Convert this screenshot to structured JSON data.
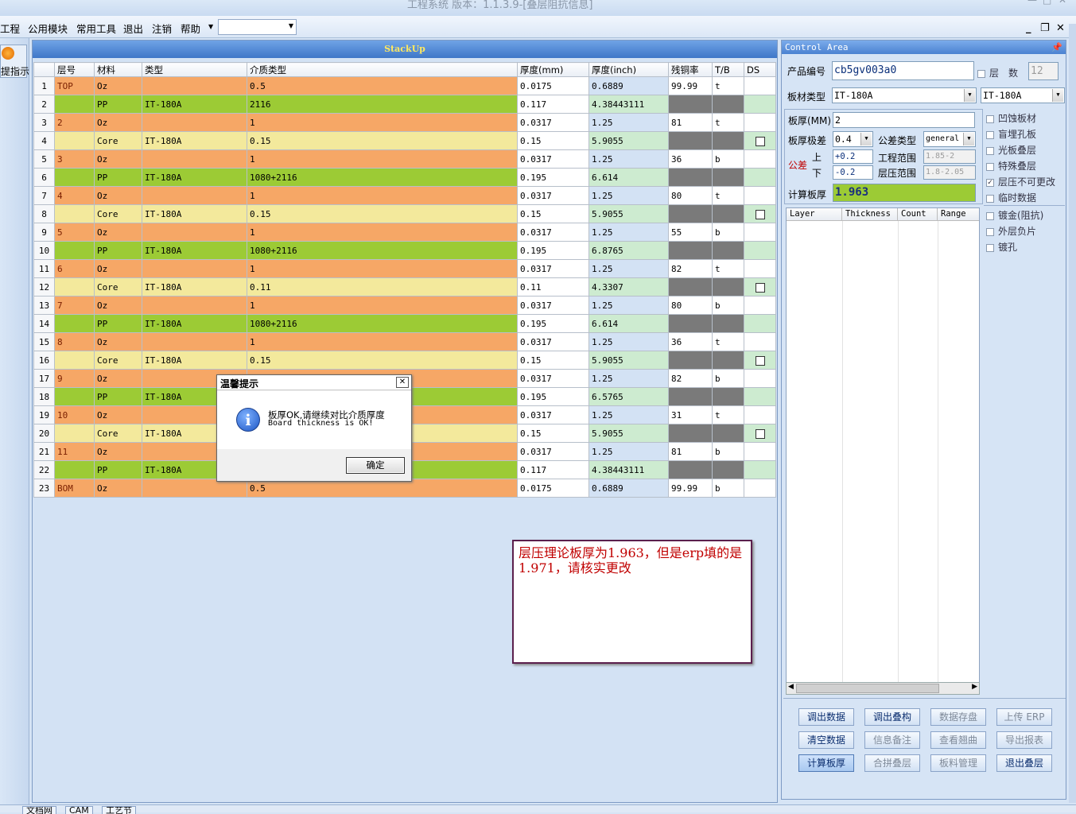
{
  "window": {
    "title": "工程系统 版本：1.1.3.9-[叠层阻抗信息]"
  },
  "menu": [
    "工程",
    "公用模块",
    "常用工具",
    "退出",
    "注销",
    "帮助"
  ],
  "left_nav": {
    "label": "提指示"
  },
  "stackup": {
    "title": "StackUp",
    "columns": [
      "层号",
      "材料",
      "类型",
      "介质类型",
      "厚度(mm)",
      "厚度(inch)",
      "残铜率",
      "T/B",
      "DS"
    ],
    "rows": [
      {
        "n": "1",
        "kind": "cu",
        "layer": "TOP",
        "mat": "Oz",
        "type": "",
        "diel": "0.5",
        "mm": "0.0175",
        "inch": "0.6889",
        "res": "99.99",
        "tb": "t",
        "ds": false
      },
      {
        "n": "2",
        "kind": "pp",
        "layer": "",
        "mat": "PP",
        "type": "IT-180A",
        "diel": "2116",
        "mm": "0.117",
        "inch": "4.38443111",
        "res": "",
        "tb": "",
        "ds": false
      },
      {
        "n": "3",
        "kind": "cu",
        "layer": "2",
        "mat": "Oz",
        "type": "",
        "diel": "1",
        "mm": "0.0317",
        "inch": "1.25",
        "res": "81",
        "tb": "t",
        "ds": false
      },
      {
        "n": "4",
        "kind": "co",
        "layer": "",
        "mat": "Core",
        "type": "IT-180A",
        "diel": "0.15",
        "mm": "0.15",
        "inch": "5.9055",
        "res": "",
        "tb": "",
        "ds": true
      },
      {
        "n": "5",
        "kind": "cu",
        "layer": "3",
        "mat": "Oz",
        "type": "",
        "diel": "1",
        "mm": "0.0317",
        "inch": "1.25",
        "res": "36",
        "tb": "b",
        "ds": false
      },
      {
        "n": "6",
        "kind": "pp",
        "layer": "",
        "mat": "PP",
        "type": "IT-180A",
        "diel": "1080+2116",
        "mm": "0.195",
        "inch": "6.614",
        "res": "",
        "tb": "",
        "ds": false
      },
      {
        "n": "7",
        "kind": "cu",
        "layer": "4",
        "mat": "Oz",
        "type": "",
        "diel": "1",
        "mm": "0.0317",
        "inch": "1.25",
        "res": "80",
        "tb": "t",
        "ds": false
      },
      {
        "n": "8",
        "kind": "co",
        "layer": "",
        "mat": "Core",
        "type": "IT-180A",
        "diel": "0.15",
        "mm": "0.15",
        "inch": "5.9055",
        "res": "",
        "tb": "",
        "ds": true
      },
      {
        "n": "9",
        "kind": "cu",
        "layer": "5",
        "mat": "Oz",
        "type": "",
        "diel": "1",
        "mm": "0.0317",
        "inch": "1.25",
        "res": "55",
        "tb": "b",
        "ds": false
      },
      {
        "n": "10",
        "kind": "pp",
        "layer": "",
        "mat": "PP",
        "type": "IT-180A",
        "diel": "1080+2116",
        "mm": "0.195",
        "inch": "6.8765",
        "res": "",
        "tb": "",
        "ds": false
      },
      {
        "n": "11",
        "kind": "cu",
        "layer": "6",
        "mat": "Oz",
        "type": "",
        "diel": "1",
        "mm": "0.0317",
        "inch": "1.25",
        "res": "82",
        "tb": "t",
        "ds": false
      },
      {
        "n": "12",
        "kind": "co",
        "layer": "",
        "mat": "Core",
        "type": "IT-180A",
        "diel": "0.11",
        "mm": "0.11",
        "inch": "4.3307",
        "res": "",
        "tb": "",
        "ds": true
      },
      {
        "n": "13",
        "kind": "cu",
        "layer": "7",
        "mat": "Oz",
        "type": "",
        "diel": "1",
        "mm": "0.0317",
        "inch": "1.25",
        "res": "80",
        "tb": "b",
        "ds": false
      },
      {
        "n": "14",
        "kind": "pp",
        "layer": "",
        "mat": "PP",
        "type": "IT-180A",
        "diel": "1080+2116",
        "mm": "0.195",
        "inch": "6.614",
        "res": "",
        "tb": "",
        "ds": false
      },
      {
        "n": "15",
        "kind": "cu",
        "layer": "8",
        "mat": "Oz",
        "type": "",
        "diel": "1",
        "mm": "0.0317",
        "inch": "1.25",
        "res": "36",
        "tb": "t",
        "ds": false
      },
      {
        "n": "16",
        "kind": "co",
        "layer": "",
        "mat": "Core",
        "type": "IT-180A",
        "diel": "0.15",
        "mm": "0.15",
        "inch": "5.9055",
        "res": "",
        "tb": "",
        "ds": true
      },
      {
        "n": "17",
        "kind": "cu",
        "layer": "9",
        "mat": "Oz",
        "type": "",
        "diel": "",
        "mm": "0.0317",
        "inch": "1.25",
        "res": "82",
        "tb": "b",
        "ds": false
      },
      {
        "n": "18",
        "kind": "pp",
        "layer": "",
        "mat": "PP",
        "type": "IT-180A",
        "diel": "",
        "mm": "0.195",
        "inch": "6.5765",
        "res": "",
        "tb": "",
        "ds": false
      },
      {
        "n": "19",
        "kind": "cu",
        "layer": "10",
        "mat": "Oz",
        "type": "",
        "diel": "",
        "mm": "0.0317",
        "inch": "1.25",
        "res": "31",
        "tb": "t",
        "ds": false
      },
      {
        "n": "20",
        "kind": "co",
        "layer": "",
        "mat": "Core",
        "type": "IT-180A",
        "diel": "",
        "mm": "0.15",
        "inch": "5.9055",
        "res": "",
        "tb": "",
        "ds": true
      },
      {
        "n": "21",
        "kind": "cu",
        "layer": "11",
        "mat": "Oz",
        "type": "",
        "diel": "",
        "mm": "0.0317",
        "inch": "1.25",
        "res": "81",
        "tb": "b",
        "ds": false
      },
      {
        "n": "22",
        "kind": "pp",
        "layer": "",
        "mat": "PP",
        "type": "IT-180A",
        "diel": "",
        "mm": "0.117",
        "inch": "4.38443111",
        "res": "",
        "tb": "",
        "ds": false
      },
      {
        "n": "23",
        "kind": "cu",
        "layer": "BOM",
        "mat": "Oz",
        "type": "",
        "diel": "0.5",
        "mm": "0.0175",
        "inch": "0.6889",
        "res": "99.99",
        "tb": "b",
        "ds": false
      }
    ]
  },
  "note": "层压理论板厚为1.963，但是erp填的是1.971，请核实更改",
  "dialog": {
    "title": "温馨提示",
    "message_cn": "板厚OK,请继续对比介质厚度",
    "message_en": "Board thickness is OK!",
    "ok": "确定"
  },
  "control": {
    "title": "Control Area",
    "product_label": "产品编号",
    "product_value": "cb5gv003a0",
    "layers_label": "层　数",
    "layers_value": "12",
    "material_label": "板材类型",
    "material_value": "IT-180A",
    "material_value2": "IT-180A",
    "thick_label": "板厚(MM)",
    "thick_value": "2",
    "thick_tol_label": "板厚极差",
    "thick_tol_value": "0.4",
    "tol_type_label": "公差类型",
    "tol_type_value": "general",
    "tol_label": "公差",
    "up_label": "上",
    "down_label": "下",
    "up_value": "+0.2",
    "down_value": "-0.2",
    "eng_range_label": "工程范围",
    "eng_range_value": "1.85-2",
    "lam_range_label": "层压范围",
    "lam_range_value": "1.8-2.05",
    "calc_label": "计算板厚",
    "calc_value": "1.963",
    "layer_grid_cols": [
      "Layer",
      "Thickness",
      "Count",
      "Range"
    ],
    "options": [
      {
        "label": "凹蚀板材",
        "checked": false
      },
      {
        "label": "盲埋孔板",
        "checked": false
      },
      {
        "label": "光板叠层",
        "checked": false
      },
      {
        "label": "特殊叠层",
        "checked": false
      },
      {
        "label": "层压不可更改",
        "checked": true
      },
      {
        "label": "临时数据",
        "checked": false
      }
    ],
    "options2": [
      {
        "label": "镀金(阻抗)",
        "checked": false
      },
      {
        "label": "外层负片",
        "checked": false
      },
      {
        "label": "镀孔",
        "checked": false
      }
    ],
    "buttons": [
      [
        "调出数据",
        "调出叠构",
        "数据存盘",
        "上传 ERP"
      ],
      [
        "清空数据",
        "信息备注",
        "查看翘曲",
        "导出报表"
      ],
      [
        "计算板厚",
        "合拼叠层",
        "板料管理",
        "退出叠层"
      ]
    ]
  },
  "taskbar": [
    "文档网",
    "CAM",
    "工艺节"
  ]
}
